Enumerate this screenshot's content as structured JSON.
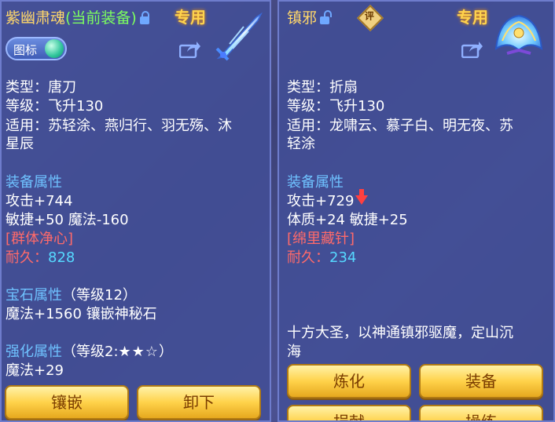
{
  "left": {
    "title_name": "紫幽肃魂",
    "title_current": "(当前装备)",
    "exclusive": "专用",
    "icon_toggle_label": "图标",
    "type": "类型：唐刀",
    "level": "等级：飞升130",
    "fit_line1": "适用：苏轻涂、燕归行、羽无殇、沐",
    "fit_line2": "星辰",
    "attr_header": "装备属性",
    "attack": "攻击+744",
    "agi_magic": "敏捷+50 魔法-160",
    "special": "[群体净心]",
    "durability_label": "耐久：",
    "durability_value": "828",
    "gem_header": "宝石属性",
    "gem_level": "（等级12）",
    "gem_attr": "魔法+1560 镶嵌神秘石",
    "enhance_header": "强化属性",
    "enhance_level": "（等级2:",
    "enhance_stars": "★★☆",
    "enhance_close": "）",
    "enhance_attr": "魔法+29",
    "buttons": [
      "镶嵌",
      "卸下"
    ]
  },
  "right": {
    "title_name": "镇邪",
    "badge": "评",
    "exclusive": "专用",
    "type": "类型：折扇",
    "level": "等级：飞升130",
    "fit_line1": "适用：龙啸云、慕子白、明无夜、苏",
    "fit_line2": "轻涂",
    "attr_header": "装备属性",
    "attack": "攻击+729",
    "con_agi": "体质+24 敏捷+25",
    "special": "[绵里藏针]",
    "durability_label": "耐久：",
    "durability_value": "234",
    "desc_line1": "十方大圣，以神通镇邪驱魔，定山沉",
    "desc_line2": "海",
    "buttons": [
      "炼化",
      "装备",
      "捐献",
      "操练"
    ]
  },
  "colors": {
    "title": "#ffd76a",
    "current_equip": "#7dff5e",
    "section_header": "#6fc2ff",
    "special": "#ff6a6a",
    "durability": "#56d8ff",
    "button_text": "#7a3c00"
  }
}
